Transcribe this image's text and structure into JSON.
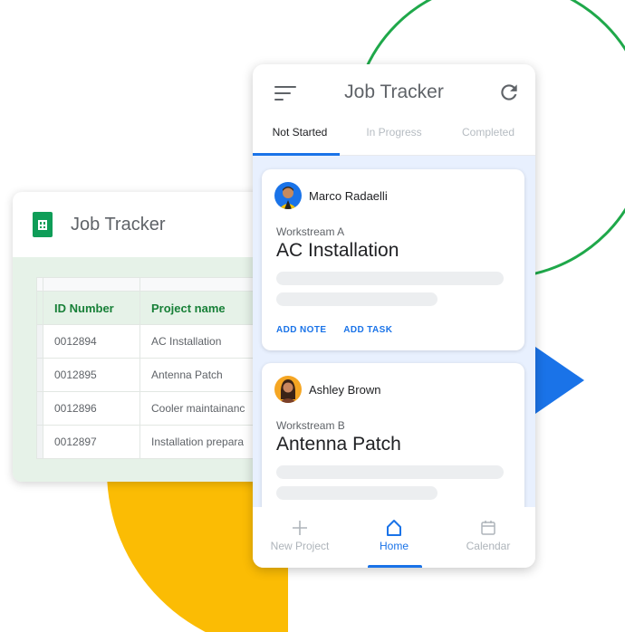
{
  "sheet": {
    "title": "Job Tracker",
    "headers": [
      "ID Number",
      "Project name"
    ],
    "rows": [
      [
        "0012894",
        "AC Installation"
      ],
      [
        "0012895",
        "Antenna Patch"
      ],
      [
        "0012896",
        "Cooler maintainanc"
      ],
      [
        "0012897",
        "Installation prepara"
      ]
    ]
  },
  "app": {
    "title": "Job Tracker",
    "tabs": [
      "Not Started",
      "In Progress",
      "Completed"
    ],
    "cards": [
      {
        "person": "Marco Radaelli",
        "workstream": "Workstream A",
        "job": "AC Installation",
        "actions": [
          "ADD NOTE",
          "ADD TASK"
        ]
      },
      {
        "person": "Ashley Brown",
        "workstream": "Workstream B",
        "job": "Antenna Patch"
      }
    ],
    "nav": [
      {
        "label": "New Project",
        "icon": "plus-icon"
      },
      {
        "label": "Home",
        "icon": "home-icon"
      },
      {
        "label": "Calendar",
        "icon": "calendar-icon"
      }
    ]
  },
  "colors": {
    "accent": "#1a73e8",
    "sheets_green": "#0f9d58",
    "circle_green": "#1fa84a",
    "yellow": "#fbbc04"
  }
}
